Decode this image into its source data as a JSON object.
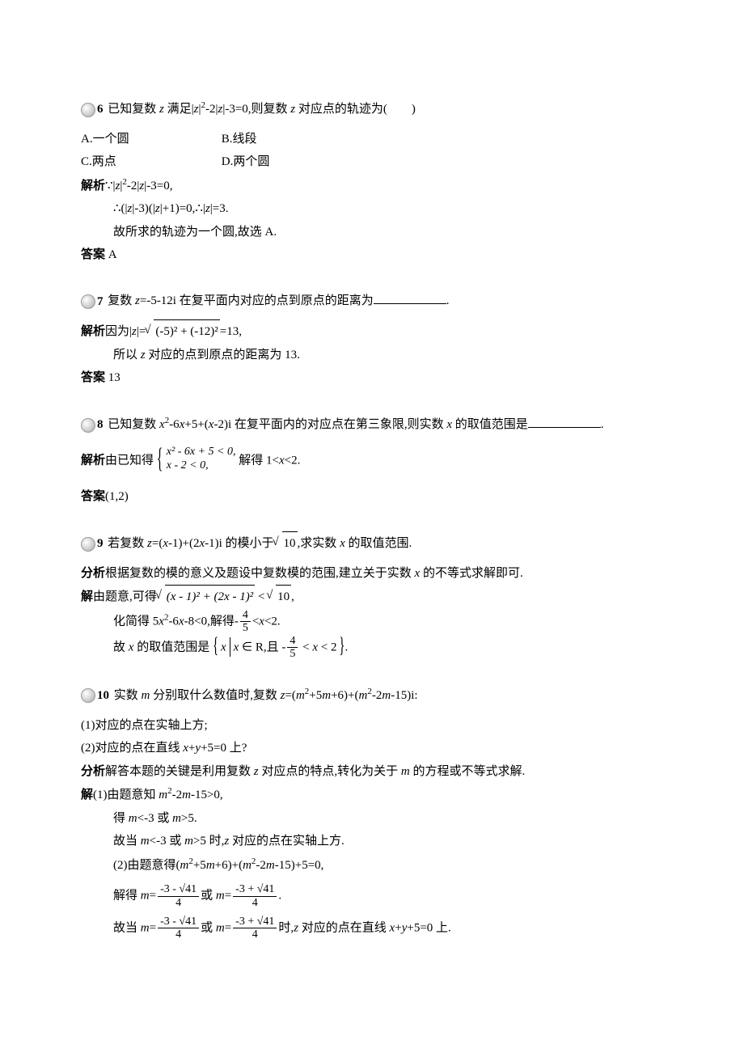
{
  "q6": {
    "num": "6",
    "text_a": "已知复数 ",
    "text_b": " 满足|",
    "text_c": "|",
    "sup2": "2",
    "text_d": "-2|",
    "text_e": "|-3=0,则复数 ",
    "text_f": " 对应点的轨迹为(　　)",
    "optA": "A.一个圆",
    "optB": "B.线段",
    "optC": "C.两点",
    "optD": "D.两个圆",
    "ana_label": "解析",
    "ana_a": "∵|",
    "ana_b": "|",
    "ana_c": "-2|",
    "ana_d": "|-3=0,",
    "ana2_a": "∴(|",
    "ana2_b": "|-3)(|",
    "ana2_c": "|+1)=0,∴|",
    "ana2_d": "|=3.",
    "ana3": "故所求的轨迹为一个圆,故选 A.",
    "ans_label": "答案",
    "ans": " A"
  },
  "q7": {
    "num": "7",
    "text_a": "复数 ",
    "text_b": "=-5-12i 在复平面内对应的点到原点的距离为",
    "period": ".",
    "ana_label": "解析",
    "ana_a": "因为|",
    "ana_b": "|=",
    "rad": "(-5)² + (-12)²",
    "ana_c": "=13,",
    "ana2_a": "所以 ",
    "ana2_b": " 对应的点到原点的距离为 13.",
    "ans_label": "答案",
    "ans": " 13"
  },
  "q8": {
    "num": "8",
    "text_a": "已知复数 ",
    "text_b": "-6",
    "text_c": "+5+(",
    "text_d": "-2)i 在复平面内的对应点在第三象限,则实数 ",
    "text_e": " 的取值范围是",
    "period": ".",
    "ana_label": "解析",
    "ana_a": "由已知得",
    "br1": "x² - 6x + 5 < 0,",
    "br2": "x - 2 < 0,",
    "ana_b": "解得 1<",
    "ana_c": "<2.",
    "ans_label": "答案",
    "ans": "(1,2)"
  },
  "q9": {
    "num": "9",
    "text_a": "若复数 ",
    "text_b": "=(",
    "text_c": "-1)+(2",
    "text_d": "-1)i 的模小于",
    "rad10": "10",
    "text_e": ",求实数 ",
    "text_f": " 的取值范围.",
    "fx_label": "分析",
    "fx": "根据复数的模的意义及题设中复数模的范围,建立关于实数 ",
    "fx_b": " 的不等式求解即可.",
    "sol_label": "解",
    "sol_a": "由题意,可得",
    "rad_expr": "(x - 1)² + (2x - 1)²",
    "lt": " < ",
    "sol_comma": ",",
    "sol2_a": "化简得 5",
    "sol2_b": "-6",
    "sol2_c": "-8<0,解得-",
    "frac_n1": "4",
    "frac_d1": "5",
    "sol2_d": "<",
    "sol2_e": "<2.",
    "sol3_a": "故 ",
    "sol3_b": " 的取值范围是",
    "set_a": " ∈ R,且 -",
    "set_b": " < ",
    "set_c": " < 2",
    "sol3_end": "."
  },
  "q10": {
    "num": "10",
    "text_a": "实数 ",
    "text_b": " 分别取什么数值时,复数 ",
    "text_c": "=(",
    "text_d": "+5",
    "text_e": "+6)+(",
    "text_f": "-2",
    "text_g": "-15)i:",
    "p1": "(1)对应的点在实轴上方;",
    "p2_a": "(2)对应的点在直线 ",
    "p2_b": "+",
    "p2_c": "+5=0 上?",
    "fx_label": "分析",
    "fx_a": "解答本题的关键是利用复数 ",
    "fx_b": " 对应点的特点,转化为关于 ",
    "fx_c": " 的方程或不等式求解.",
    "sol_label": "解",
    "s1_a": "(1)由题意知 ",
    "s1_b": "-2",
    "s1_c": "-15>0,",
    "s1d_a": "得 ",
    "s1d_b": "<-3 或 ",
    "s1d_c": ">5.",
    "s1e_a": "故当 ",
    "s1e_b": "<-3 或 ",
    "s1e_c": ">5 时,",
    "s1e_d": " 对应的点在实轴上方.",
    "s2_a": "(2)由题意得(",
    "s2_b": "+5",
    "s2_c": "+6)+(",
    "s2_d": "-2",
    "s2_e": "-15)+5=0,",
    "s2f_a": "解得 ",
    "s2f_b": "=",
    "fn1": "-3 - √41",
    "fd1": "4",
    "s2f_c": "或 ",
    "fn2": "-3 + √41",
    "fd2": "4",
    "s2f_end": ".",
    "s2g_a": "故当 ",
    "s2g_b": "时,",
    "s2g_c": " 对应的点在直线 ",
    "s2g_d": "+",
    "s2g_e": "+5=0 上."
  },
  "vars": {
    "z": "z",
    "x": "x",
    "m": "m",
    "y": "y"
  }
}
